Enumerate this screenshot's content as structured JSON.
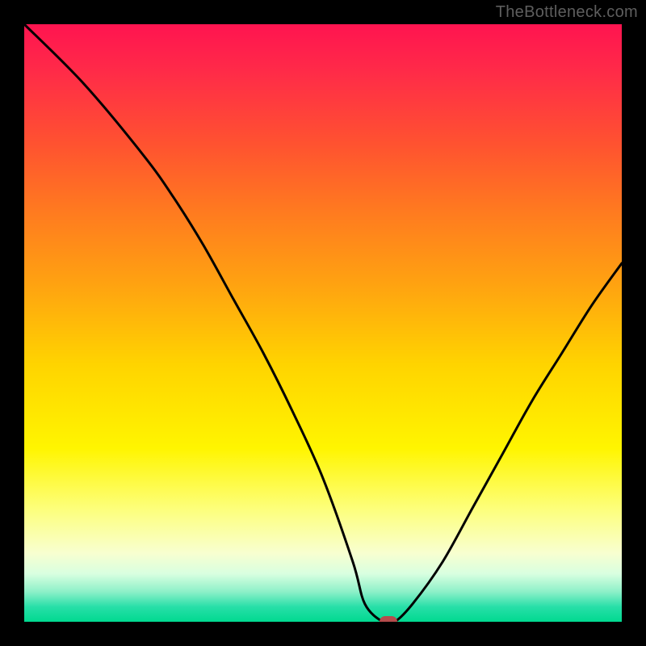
{
  "watermark": "TheBottleneck.com",
  "colors": {
    "frame": "#000000",
    "curve_stroke": "#000000",
    "marker_fill": "#b54c4c",
    "watermark_text": "#5e5e5e"
  },
  "chart_data": {
    "type": "line",
    "title": "",
    "xlabel": "",
    "ylabel": "",
    "xlim": [
      0,
      100
    ],
    "ylim": [
      0,
      100
    ],
    "series": [
      {
        "name": "bottleneck-curve",
        "x": [
          0,
          10,
          20,
          25,
          30,
          35,
          40,
          45,
          50,
          55,
          57,
          60,
          62,
          65,
          70,
          75,
          80,
          85,
          90,
          95,
          100
        ],
        "values": [
          100,
          90,
          78,
          71,
          63,
          54,
          45,
          35,
          24,
          10,
          3,
          0,
          0,
          3,
          10,
          19,
          28,
          37,
          45,
          53,
          60
        ]
      }
    ],
    "annotations": [
      {
        "kind": "marker",
        "x": 61,
        "y": 0,
        "color": "#b54c4c"
      }
    ],
    "background": {
      "type": "vertical-gradient",
      "stops": [
        {
          "pct": 0,
          "color": "#ff1450"
        },
        {
          "pct": 8,
          "color": "#ff2b48"
        },
        {
          "pct": 20,
          "color": "#ff5230"
        },
        {
          "pct": 31,
          "color": "#ff7920"
        },
        {
          "pct": 44,
          "color": "#ffa410"
        },
        {
          "pct": 57,
          "color": "#ffd400"
        },
        {
          "pct": 71,
          "color": "#fff500"
        },
        {
          "pct": 81,
          "color": "#fdff7a"
        },
        {
          "pct": 88.5,
          "color": "#f8ffd0"
        },
        {
          "pct": 92,
          "color": "#d8ffe0"
        },
        {
          "pct": 95,
          "color": "#8cf0c8"
        },
        {
          "pct": 97.5,
          "color": "#28dfa8"
        },
        {
          "pct": 100,
          "color": "#00d990"
        }
      ]
    }
  }
}
